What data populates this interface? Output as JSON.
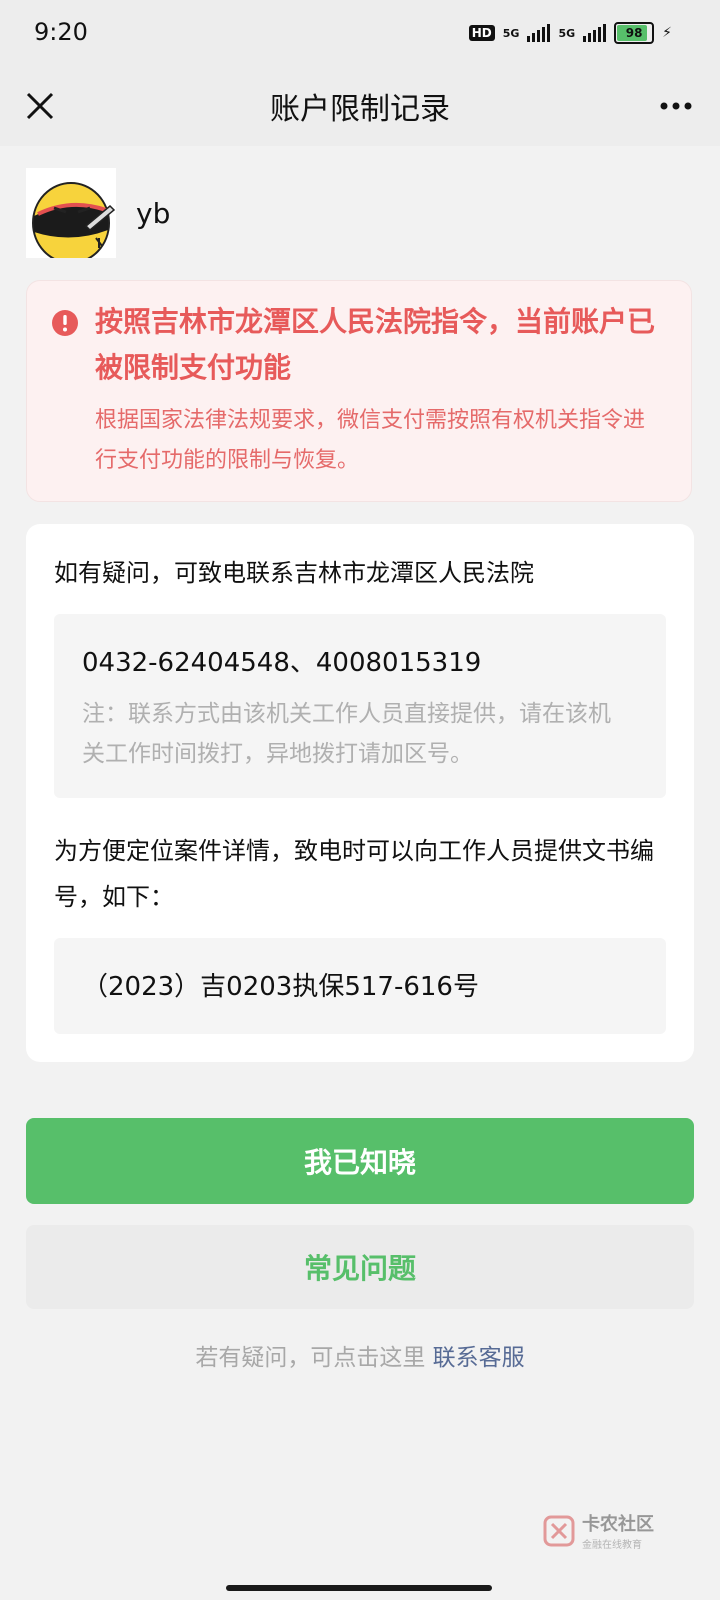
{
  "status_bar": {
    "time": "9:20",
    "hd_label": "HD",
    "signal_1_label": "5G",
    "signal_2_label": "5G",
    "battery_level": "98",
    "battery_fraction": 0.98,
    "charging": true
  },
  "nav": {
    "title": "账户限制记录",
    "close_icon": "close-icon",
    "more_icon": "more-icon"
  },
  "user": {
    "name": "yb"
  },
  "alert": {
    "title": "按照吉林市龙潭区人民法院指令，当前账户已被限制支付功能",
    "body": "根据国家法律法规要求，微信支付需按照有权机关指令进行支付功能的限制与恢复。",
    "icon": "exclamation-icon",
    "color": "#e75a5a"
  },
  "info_card": {
    "contact_intro": "如有疑问，可致电联系吉林市龙潭区人民法院",
    "phone_numbers": "0432-62404548、4008015319",
    "note": "注：联系方式由该机关工作人员直接提供，请在该机关工作时间拨打，异地拨打请加区号。",
    "doc_intro": "为方便定位案件详情，致电时可以向工作人员提供文书编号，如下：",
    "doc_number": "（2023）吉0203执保517-616号"
  },
  "buttons": {
    "acknowledge": "我已知晓",
    "faq": "常见问题"
  },
  "help": {
    "prefix": "若有疑问，可点击这里",
    "link": "联系客服"
  },
  "watermark": {
    "main": "卡农社区",
    "sub": "金融在线教育"
  },
  "colors": {
    "primary_green": "#57bf6a",
    "alert_red": "#e75a5a",
    "link_blue": "#576b95"
  }
}
